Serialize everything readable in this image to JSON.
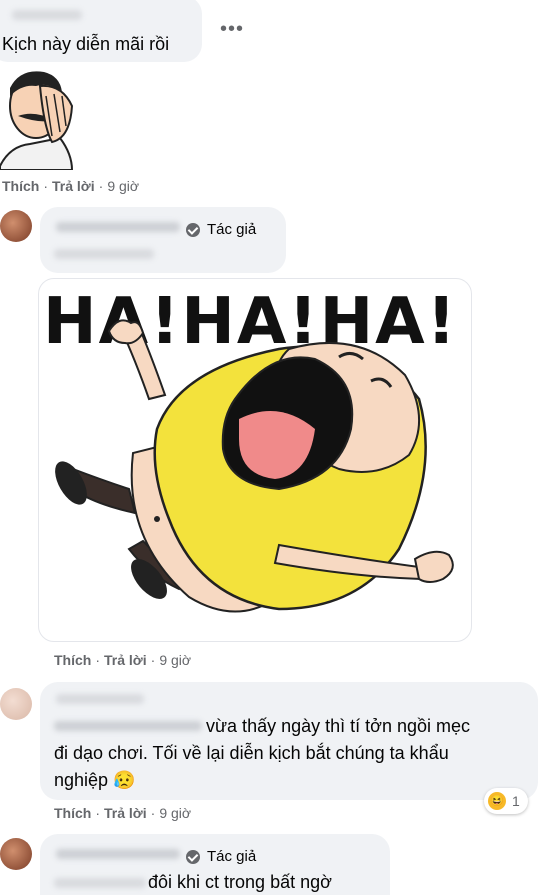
{
  "comments": [
    {
      "text": "Kịch này diễn mãi rồi",
      "actions": {
        "like": "Thích",
        "reply": "Trả lời",
        "time": "9 giờ"
      }
    },
    {
      "author_badge": "Tác giả",
      "actions": {
        "like": "Thích",
        "reply": "Trả lời",
        "time": "9 giờ"
      }
    },
    {
      "text_line1": "vừa thấy ngày thì tí tởn ngồi mẹc",
      "text_line2": "đi dạo chơi. Tối về lại diễn kịch bắt chúng ta khẩu",
      "text_line3": "nghiệp 😥",
      "actions": {
        "like": "Thích",
        "reply": "Trả lời",
        "time": "9 giờ"
      },
      "reaction_count": "1"
    },
    {
      "author_badge": "Tác giả",
      "text": "đôi khi ct trong bất ngờ"
    }
  ],
  "sticker": {
    "caption": "HA!HA!HA!"
  },
  "icons": {
    "more": "more-options-icon",
    "verified": "verified-check-icon",
    "reaction": "haha-reaction-icon"
  },
  "colors": {
    "bubble": "#f0f2f5",
    "meta": "#65676b",
    "sticker_yellow": "#f3e23c"
  }
}
